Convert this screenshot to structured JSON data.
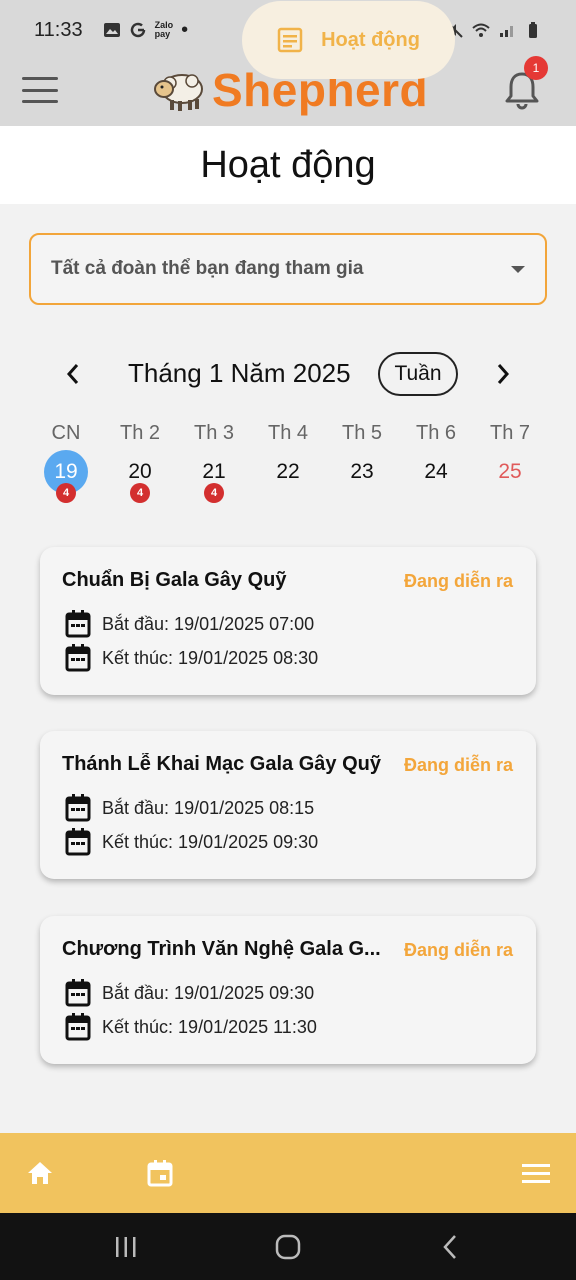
{
  "status_bar": {
    "time": "11:33",
    "zalo_line1": "Zalo",
    "zalo_line2": "pay",
    "dot": "•"
  },
  "app_bar": {
    "brand": "Shepherd",
    "notification_count": "1"
  },
  "page": {
    "title": "Hoạt động"
  },
  "filter": {
    "selected": "Tất cả đoàn thể bạn đang tham gia"
  },
  "calendar": {
    "month_label": "Tháng 1 Năm 2025",
    "view_toggle": "Tuần",
    "prev": "‹",
    "next": "›",
    "weekdays": [
      "CN",
      "Th 2",
      "Th 3",
      "Th 4",
      "Th 5",
      "Th 6",
      "Th 7"
    ],
    "days": [
      {
        "num": "19",
        "badge": "4"
      },
      {
        "num": "20",
        "badge": "4"
      },
      {
        "num": "21",
        "badge": "4"
      },
      {
        "num": "22"
      },
      {
        "num": "23"
      },
      {
        "num": "24"
      },
      {
        "num": "25"
      }
    ]
  },
  "events": [
    {
      "title": "Chuẩn Bị Gala Gây Quỹ",
      "status": "Đang diễn ra",
      "start": "Bắt đầu: 19/01/2025 07:00",
      "end": "Kết thúc: 19/01/2025 08:30"
    },
    {
      "title": "Thánh Lễ Khai Mạc Gala Gây Quỹ",
      "status": "Đang diễn ra",
      "start": "Bắt đầu: 19/01/2025 08:15",
      "end": "Kết thúc: 19/01/2025 09:30"
    },
    {
      "title": "Chương Trình Văn Nghệ Gala G...",
      "status": "Đang diễn ra",
      "start": "Bắt đầu: 19/01/2025 09:30",
      "end": "Kết thúc: 19/01/2025 11:30"
    }
  ],
  "bottom_nav": {
    "active_label": "Hoạt động"
  },
  "colors": {
    "brand": "#f07b22",
    "accent": "#f3a63b",
    "selected_day": "#5aa9f0",
    "badge": "#d32f2f",
    "nav_bg": "#f1c35e"
  }
}
